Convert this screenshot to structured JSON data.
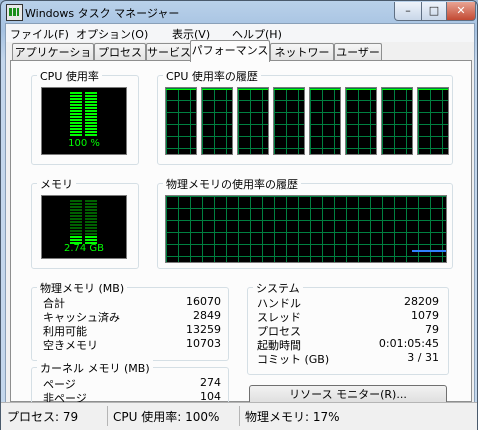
{
  "window": {
    "title": "Windows タスク マネージャー",
    "minimize_glyph": "–",
    "maximize_glyph": "□",
    "close_glyph": "✕"
  },
  "menu": [
    {
      "label": "ファイル(F)"
    },
    {
      "label": "オプション(O)"
    },
    {
      "label": "表示(V)"
    },
    {
      "label": "ヘルプ(H)"
    }
  ],
  "tabs": [
    {
      "label": "アプリケーション",
      "active": false
    },
    {
      "label": "プロセス",
      "active": false
    },
    {
      "label": "サービス",
      "active": false
    },
    {
      "label": "パフォーマンス",
      "active": true
    },
    {
      "label": "ネットワーク",
      "active": false
    },
    {
      "label": "ユーザー",
      "active": false
    }
  ],
  "cpu_usage": {
    "label": "CPU 使用率",
    "value_text": "100 %",
    "level": 1.0
  },
  "cpu_history": {
    "label": "CPU 使用率の履歴",
    "cores": 8
  },
  "memory_meter": {
    "label": "メモリ",
    "value_text": "2.74 GB",
    "level": 0.17
  },
  "memory_history": {
    "label": "物理メモリの使用率の履歴"
  },
  "physical_memory": {
    "label": "物理メモリ (MB)",
    "rows": [
      {
        "label": "合計",
        "value": "16070"
      },
      {
        "label": "キャッシュ済み",
        "value": "2849"
      },
      {
        "label": "利用可能",
        "value": "13259"
      },
      {
        "label": "空きメモリ",
        "value": "10703"
      }
    ]
  },
  "kernel_memory": {
    "label": "カーネル メモリ (MB)",
    "rows": [
      {
        "label": "ページ",
        "value": "274"
      },
      {
        "label": "非ページ",
        "value": "104"
      }
    ]
  },
  "system": {
    "label": "システム",
    "rows": [
      {
        "label": "ハンドル",
        "value": "28209"
      },
      {
        "label": "スレッド",
        "value": "1079"
      },
      {
        "label": "プロセス",
        "value": "79"
      },
      {
        "label": "起動時間",
        "value": "0:01:05:45"
      },
      {
        "label": "コミット (GB)",
        "value": "3 / 31"
      }
    ]
  },
  "resource_monitor_button": "リソース モニター(R)...",
  "statusbar": {
    "processes": "プロセス: 79",
    "cpu": "CPU 使用率: 100%",
    "memory": "物理メモリ: 17%"
  },
  "colors": {
    "meter_on": "#00ff00",
    "meter_off": "#006000",
    "grid": "#008040",
    "mem_line": "#3080ff"
  }
}
